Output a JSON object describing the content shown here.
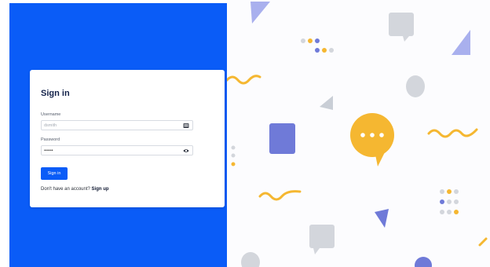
{
  "login": {
    "title": "Sign in",
    "username_label": "Username",
    "username_placeholder": "dsmith",
    "password_label": "Password",
    "password_value": "••••••",
    "signin_button": "Sign in",
    "footer_text": "Don't have an account?",
    "signup_link": "Sign up"
  },
  "colors": {
    "brand": "#0a5cf7",
    "yellow": "#f5b731",
    "purple": "#6f7ad8",
    "gray": "#d3d6dc"
  },
  "icons": {
    "username": "id-card-icon",
    "password": "eye-icon"
  }
}
